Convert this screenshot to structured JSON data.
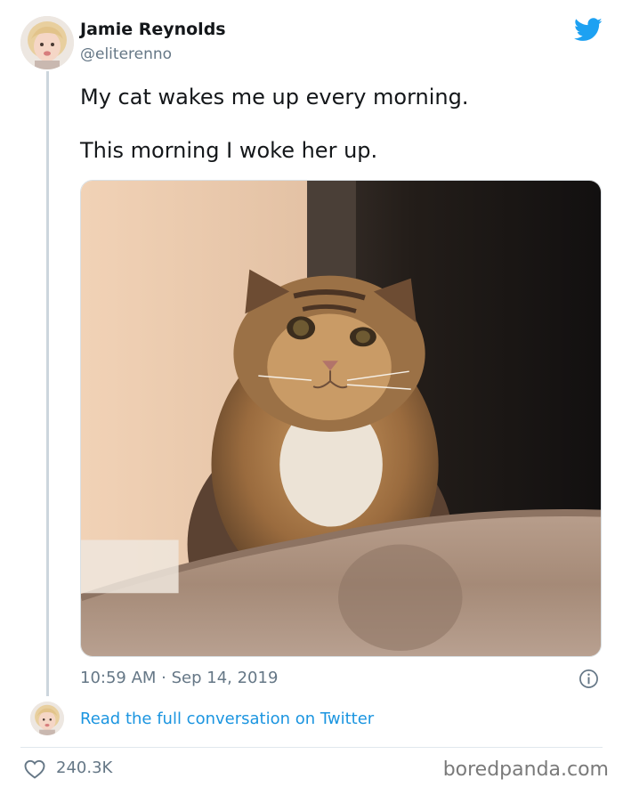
{
  "tweet": {
    "author_name": "Jamie Reynolds",
    "author_handle": "@eliterenno",
    "text_line_1": "My cat wakes me up every morning.",
    "text_line_2": "This morning I woke her up.",
    "timestamp": "10:59 AM · Sep 14, 2019",
    "read_link": "Read the full conversation on Twitter",
    "like_count": "240.3K"
  },
  "watermark": "boredpanda.com",
  "icons": {
    "brand": "twitter-bird-icon",
    "info": "info-icon",
    "like": "heart-icon"
  },
  "colors": {
    "twitter_blue": "#1da1f2",
    "link_blue": "#1b95e0",
    "secondary_text": "#657786",
    "thread_line": "#ccd6dd"
  }
}
